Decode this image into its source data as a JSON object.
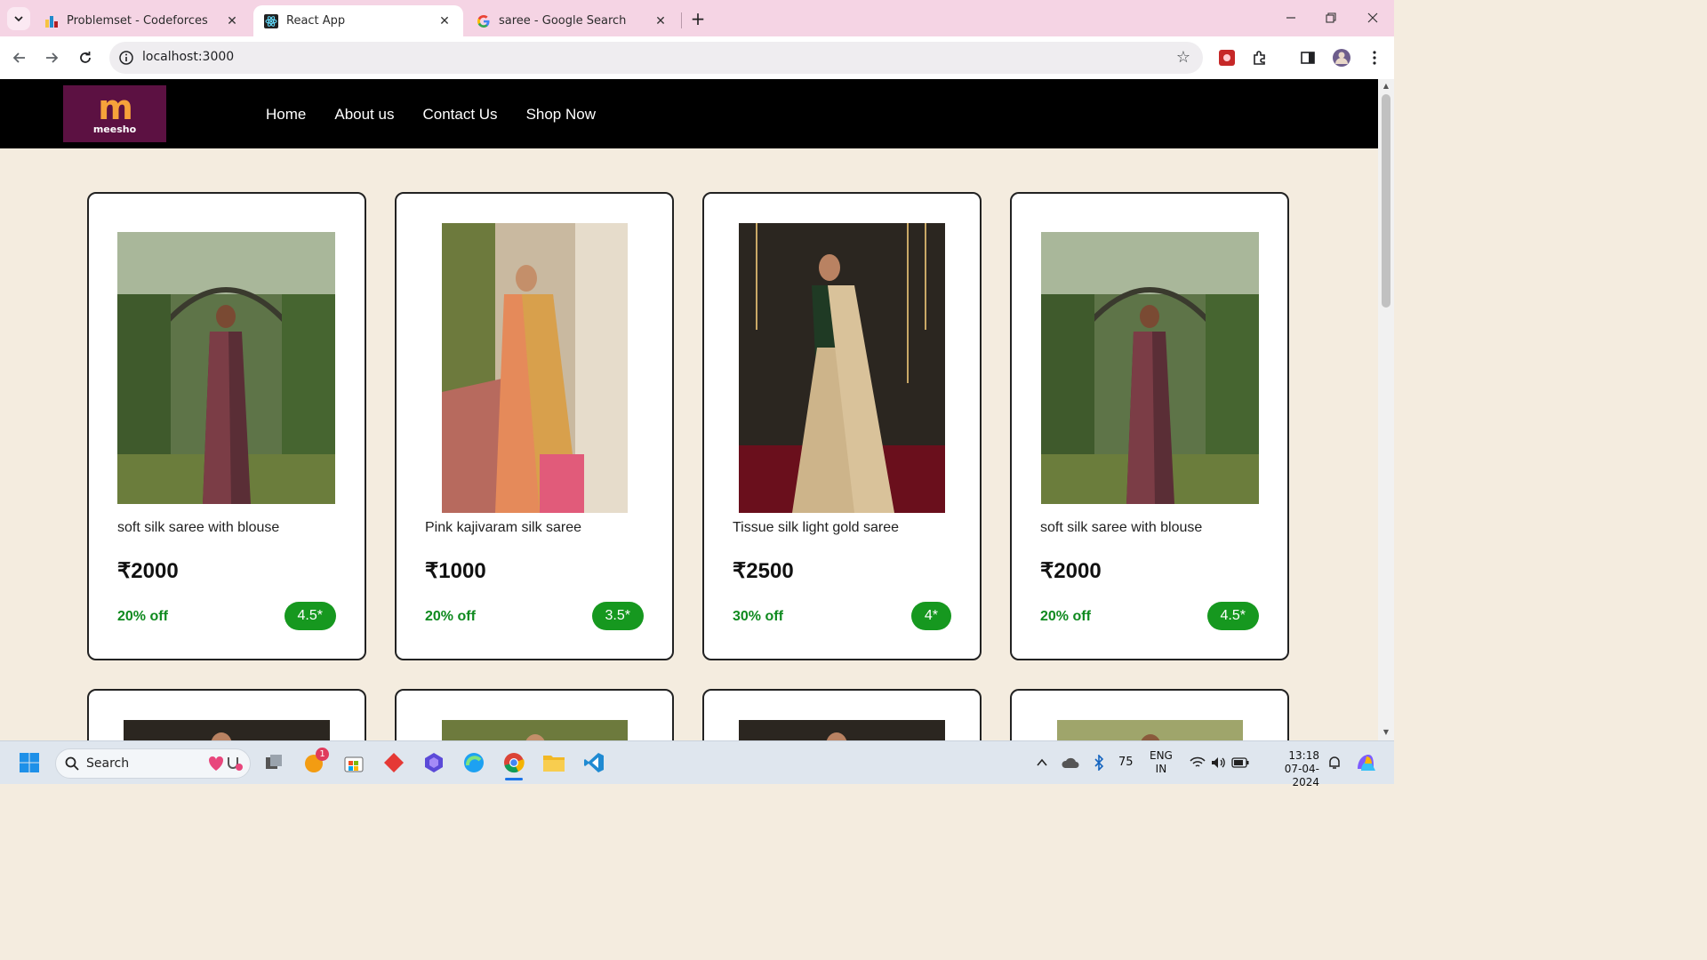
{
  "browser": {
    "tabs": [
      {
        "title": "Problemset - Codeforces",
        "active": false
      },
      {
        "title": "React App",
        "active": true
      },
      {
        "title": "saree - Google Search",
        "active": false
      }
    ],
    "url": "localhost:3000"
  },
  "site": {
    "logo_text": "meesho",
    "logo_mark": "m",
    "nav": [
      "Home",
      "About us",
      "Contact Us",
      "Shop Now"
    ]
  },
  "products": [
    {
      "name": "soft silk saree with blouse",
      "price": "₹2000",
      "discount": "20% off",
      "rating": "4.5*"
    },
    {
      "name": "Pink kajivaram silk saree",
      "price": "₹1000",
      "discount": "20% off",
      "rating": "3.5*"
    },
    {
      "name": "Tissue silk light gold saree",
      "price": "₹2500",
      "discount": "30% off",
      "rating": "4*"
    },
    {
      "name": "soft silk saree with blouse",
      "price": "₹2000",
      "discount": "20% off",
      "rating": "4.5*"
    }
  ],
  "taskbar": {
    "search_label": "Search",
    "notification_badge": "1",
    "temperature": "75",
    "language": "ENG",
    "region": "IN",
    "time": "13:18",
    "date": "07-04-2024"
  },
  "colors": {
    "navbar_bg": "#000000",
    "logo_bg": "#5c1142",
    "logo_accent": "#f6a23a",
    "page_bg": "#f4ecdf",
    "rating_bg": "#16981f",
    "discount_text": "#0f8a1f",
    "tabstrip_bg": "#f5d4e4"
  }
}
